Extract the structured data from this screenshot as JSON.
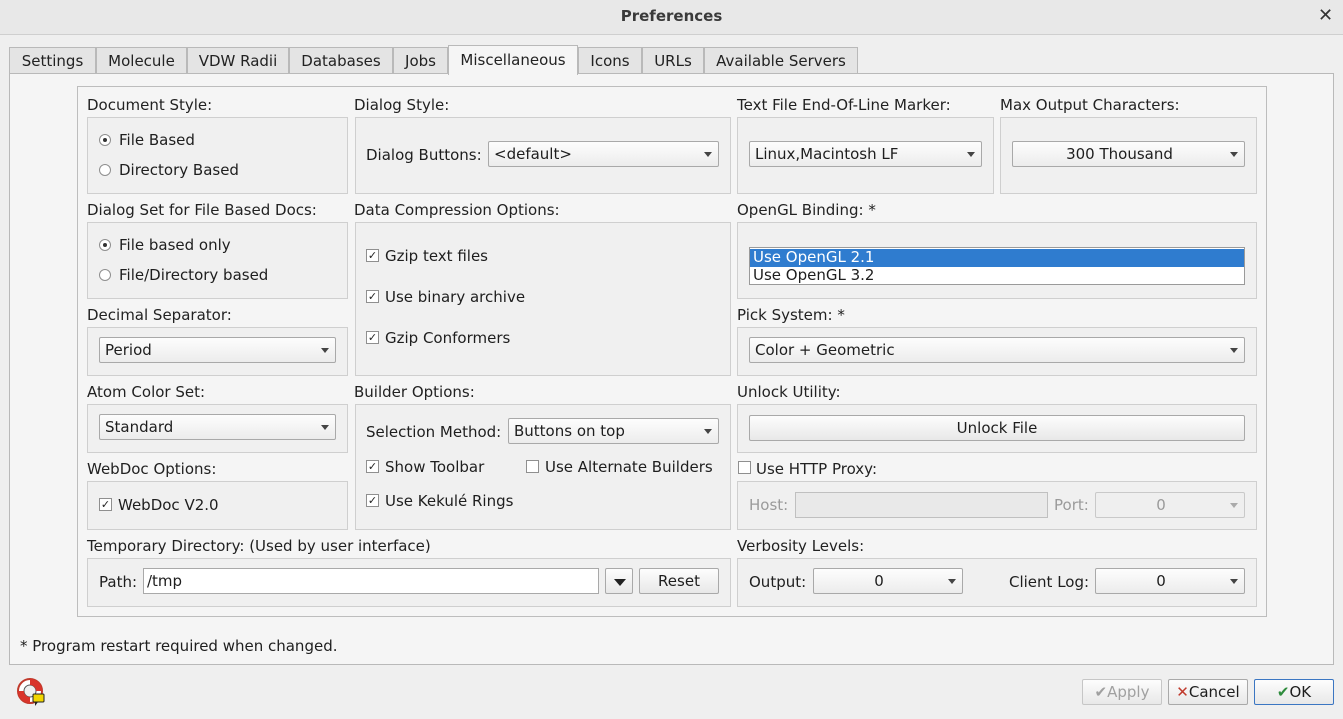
{
  "window": {
    "title": "Preferences"
  },
  "tabs": [
    "Settings",
    "Molecule",
    "VDW Radii",
    "Databases",
    "Jobs",
    "Miscellaneous",
    "Icons",
    "URLs",
    "Available Servers"
  ],
  "document_style": {
    "label": "Document Style:",
    "options": [
      "File Based",
      "Directory Based"
    ],
    "selected": "File Based"
  },
  "dialog_style": {
    "label": "Dialog Style:",
    "buttons_label": "Dialog Buttons:",
    "buttons_value": "<default>"
  },
  "eol": {
    "label": "Text File End-Of-Line Marker:",
    "value": "Linux,Macintosh LF"
  },
  "max_output": {
    "label": "Max Output Characters:",
    "value": "300 Thousand"
  },
  "dialog_set": {
    "label": "Dialog Set for File Based Docs:",
    "options": [
      "File based only",
      "File/Directory based"
    ],
    "selected": "File based only"
  },
  "compression": {
    "label": "Data Compression Options:",
    "items": [
      "Gzip text files",
      "Use binary archive",
      "Gzip Conformers"
    ]
  },
  "opengl": {
    "label": "OpenGL Binding: *",
    "options": [
      "Use OpenGL 2.1",
      "Use OpenGL 3.2"
    ],
    "selected": "Use OpenGL 2.1"
  },
  "decimal": {
    "label": "Decimal  Separator:",
    "value": "Period"
  },
  "pick": {
    "label": "Pick System: *",
    "value": "Color + Geometric"
  },
  "atom_color": {
    "label": "Atom Color Set:",
    "value": "Standard"
  },
  "builder": {
    "label": "Builder Options:",
    "selection_label": "Selection Method:",
    "selection_value": "Buttons on top",
    "show_toolbar": "Show Toolbar",
    "alt_builders": "Use Alternate Builders",
    "kekule": "Use Kekulé Rings"
  },
  "unlock": {
    "label": "Unlock Utility:",
    "button": "Unlock File"
  },
  "webdoc": {
    "label": "WebDoc Options:",
    "item": "WebDoc V2.0"
  },
  "proxy": {
    "label": "Use HTTP Proxy:",
    "host_label": "Host:",
    "port_label": "Port:",
    "port_value": "0"
  },
  "tempdir": {
    "label": "Temporary Directory: (Used by user interface)",
    "path_label": "Path:",
    "path_value": "/tmp",
    "reset": "Reset"
  },
  "verbosity": {
    "label": "Verbosity Levels:",
    "output_label": "Output:",
    "output_value": "0",
    "client_label": "Client Log:",
    "client_value": "0"
  },
  "footer_note": "* Program restart required when changed.",
  "buttons": {
    "apply": "Apply",
    "cancel": "Cancel",
    "ok": "OK"
  },
  "icons": {
    "help": "help-lifebuoy-icon",
    "apply": "checkmark-icon",
    "cancel": "x-icon",
    "ok": "checkmark-icon"
  },
  "colors": {
    "selection": "#2f7ccf",
    "cancel_x": "#c0392b",
    "ok_check": "#2e8b3c"
  }
}
